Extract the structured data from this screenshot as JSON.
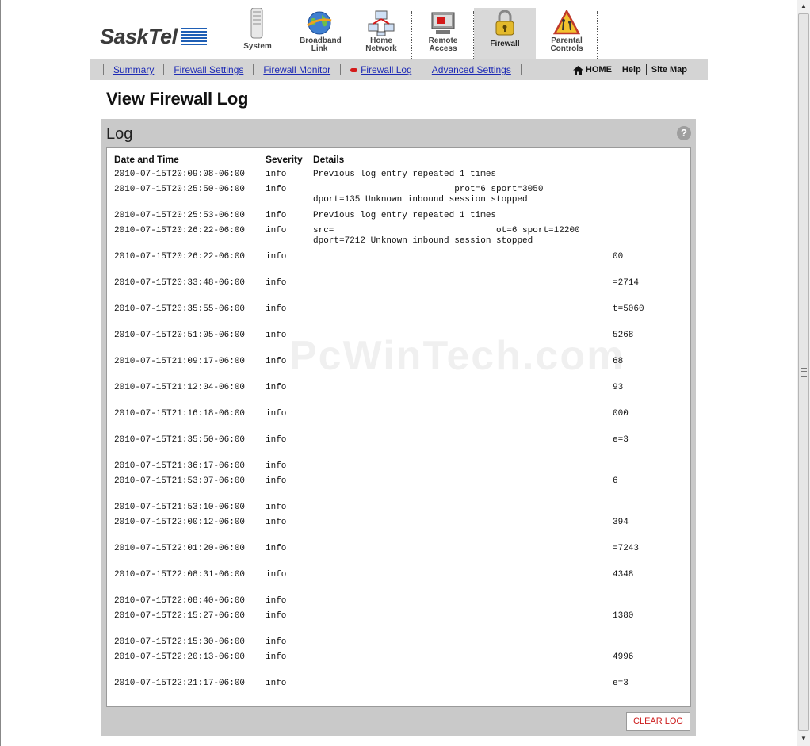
{
  "brand": {
    "logo_text": "SaskTel"
  },
  "nav_tabs": [
    {
      "label": "System",
      "icon": "system-tower-icon"
    },
    {
      "label": "Broadband Link",
      "icon": "globe-icon"
    },
    {
      "label": "Home Network",
      "icon": "network-computers-icon"
    },
    {
      "label": "Remote Access",
      "icon": "remote-computer-icon"
    },
    {
      "label": "Firewall",
      "icon": "padlock-icon",
      "active": true
    },
    {
      "label": "Parental Controls",
      "icon": "warning-sign-icon"
    }
  ],
  "subnav": {
    "links": [
      "Summary",
      "Firewall Settings",
      "Firewall Monitor",
      "Firewall Log",
      "Advanced Settings"
    ],
    "active": "Firewall Log",
    "right": [
      "HOME",
      "Help",
      "Site Map"
    ]
  },
  "page_title": "View Firewall Log",
  "log": {
    "title": "Log",
    "headers": {
      "date": "Date and Time",
      "severity": "Severity",
      "details": "Details"
    },
    "rows": [
      {
        "date": "2010-07-15T20:09:08-06:00",
        "severity": "info",
        "details": "Previous log entry repeated 1 times",
        "tail": ""
      },
      {
        "date": "2010-07-15T20:25:50-06:00",
        "severity": "info",
        "details": "                           prot=6 sport=3050\ndport=135 Unknown inbound session stopped",
        "tail": ""
      },
      {
        "date": "2010-07-15T20:25:53-06:00",
        "severity": "info",
        "details": "Previous log entry repeated 1 times",
        "tail": ""
      },
      {
        "date": "2010-07-15T20:26:22-06:00",
        "severity": "info",
        "details": "src=                               ot=6 sport=12200\ndport=7212 Unknown inbound session stopped",
        "tail": ""
      },
      {
        "date": "2010-07-15T20:26:22-06:00",
        "severity": "info",
        "details": "",
        "tail": "00"
      },
      {
        "date": "2010-07-15T20:33:48-06:00",
        "severity": "info",
        "details": "",
        "tail": "=2714"
      },
      {
        "date": "2010-07-15T20:35:55-06:00",
        "severity": "info",
        "details": "",
        "tail": "t=5060"
      },
      {
        "date": "2010-07-15T20:51:05-06:00",
        "severity": "info",
        "details": "",
        "tail": "5268"
      },
      {
        "date": "2010-07-15T21:09:17-06:00",
        "severity": "info",
        "details": "",
        "tail": "68"
      },
      {
        "date": "2010-07-15T21:12:04-06:00",
        "severity": "info",
        "details": "",
        "tail": "93"
      },
      {
        "date": "2010-07-15T21:16:18-06:00",
        "severity": "info",
        "details": "",
        "tail": "000"
      },
      {
        "date": "2010-07-15T21:35:50-06:00",
        "severity": "info",
        "details": "",
        "tail": "e=3"
      },
      {
        "date": "2010-07-15T21:36:17-06:00",
        "severity": "info",
        "details": "",
        "tail": ""
      },
      {
        "date": "2010-07-15T21:53:07-06:00",
        "severity": "info",
        "details": "",
        "tail": "6"
      },
      {
        "date": "2010-07-15T21:53:10-06:00",
        "severity": "info",
        "details": "",
        "tail": ""
      },
      {
        "date": "2010-07-15T22:00:12-06:00",
        "severity": "info",
        "details": "",
        "tail": "394"
      },
      {
        "date": "2010-07-15T22:01:20-06:00",
        "severity": "info",
        "details": "",
        "tail": "=7243"
      },
      {
        "date": "2010-07-15T22:08:31-06:00",
        "severity": "info",
        "details": "",
        "tail": "4348"
      },
      {
        "date": "2010-07-15T22:08:40-06:00",
        "severity": "info",
        "details": "",
        "tail": ""
      },
      {
        "date": "2010-07-15T22:15:27-06:00",
        "severity": "info",
        "details": "",
        "tail": "1380"
      },
      {
        "date": "2010-07-15T22:15:30-06:00",
        "severity": "info",
        "details": "",
        "tail": ""
      },
      {
        "date": "2010-07-15T22:20:13-06:00",
        "severity": "info",
        "details": "",
        "tail": "4996"
      },
      {
        "date": "2010-07-15T22:21:17-06:00",
        "severity": "info",
        "details": "",
        "tail": "e=3"
      }
    ],
    "clear_button": "CLEAR LOG",
    "help_glyph": "?"
  },
  "watermark": "PcWinTech.com",
  "colors": {
    "link": "#1e2bb5",
    "accent_red": "#d41a1a",
    "logo_blue": "#1f5fb5",
    "panel_gray": "#c9c9c9",
    "subnav_gray": "#d4d4d4"
  }
}
